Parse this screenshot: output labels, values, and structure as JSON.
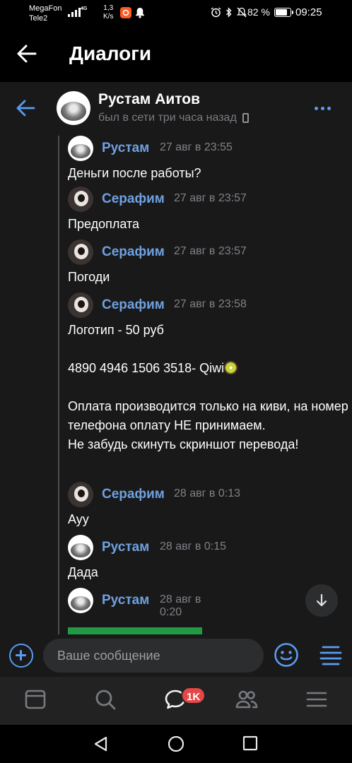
{
  "status_bar": {
    "carrier1": "MegaFon",
    "carrier2": "Tele2",
    "network": "4G",
    "speed_value": "1,3",
    "speed_unit": "K/s",
    "battery_pct": "82 %",
    "battery_level": 0.82,
    "time": "09:25"
  },
  "header": {
    "title": "Диалоги"
  },
  "chat": {
    "name": "Рустам Аитов",
    "status": "был в сети три часа назад"
  },
  "messages": [
    {
      "author": "Рустам",
      "time": "27 авг в 23:55",
      "text": "Деньги после работы?"
    },
    {
      "author": "Серафим",
      "time": "27 авг в 23:57",
      "text": "Предоплата"
    },
    {
      "author": "Серафим",
      "time": "27 авг в 23:57",
      "text": "Погоди"
    },
    {
      "author": "Серафим",
      "time": "27 авг в 23:58",
      "text_line1": "Логотип - 50 руб",
      "text_card": "4890 4946 1506 3518- Qiwi",
      "text_rest": "Оплата производится только на киви, на номер телефона оплату НЕ принимаем.\nНе забудь скинуть скриншот перевода!"
    },
    {
      "author": "Серафим",
      "time": "28 авг в 0:13",
      "text": "Ауу"
    },
    {
      "author": "Рустам",
      "time": "28 авг в 0:15",
      "text": "Дада"
    },
    {
      "author": "Рустам",
      "time": "28 авг в 0:20"
    }
  ],
  "composer": {
    "placeholder": "Ваше сообщение"
  },
  "tabbar": {
    "messages_badge": "1K"
  },
  "colors": {
    "accent": "#5a9bf0",
    "author_name": "#6fa1e0",
    "panel_bg": "#19191a",
    "badge": "#e64646"
  }
}
